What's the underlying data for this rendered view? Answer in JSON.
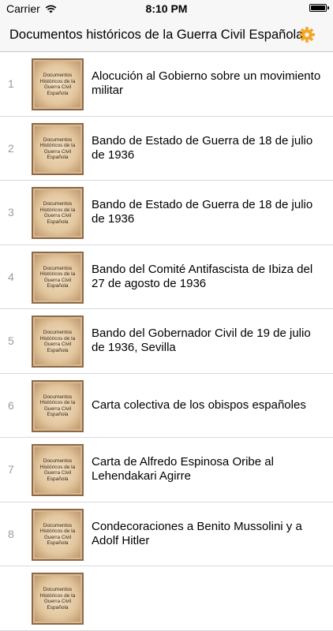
{
  "status_bar": {
    "carrier": "Carrier",
    "time": "8:10 PM",
    "battery_level": 1.0
  },
  "nav": {
    "title": "Documentos históricos de la Guerra Civil Española",
    "settings_icon": "gear-icon",
    "accent_color": "#f5a623"
  },
  "thumbnail_text": "Documentos Históricos de la Guerra Civil Española",
  "items": [
    {
      "num": "1",
      "title": "Alocución al Gobierno sobre un movimiento militar"
    },
    {
      "num": "2",
      "title": "Bando de Estado de Guerra de 18 de julio de 1936"
    },
    {
      "num": "3",
      "title": "Bando de Estado de Guerra de 18 de julio de 1936"
    },
    {
      "num": "4",
      "title": "Bando del Comité Antifascista de Ibiza del 27 de agosto de 1936"
    },
    {
      "num": "5",
      "title": "Bando del Gobernador Civil de 19 de julio de 1936, Sevilla"
    },
    {
      "num": "6",
      "title": "Carta colectiva de los obispos españoles"
    },
    {
      "num": "7",
      "title": "Carta de Alfredo Espinosa Oribe al Lehendakari Agirre"
    },
    {
      "num": "8",
      "title": "Condecoraciones a Benito Mussolini y a Adolf Hitler"
    },
    {
      "num": "",
      "title": ""
    }
  ]
}
